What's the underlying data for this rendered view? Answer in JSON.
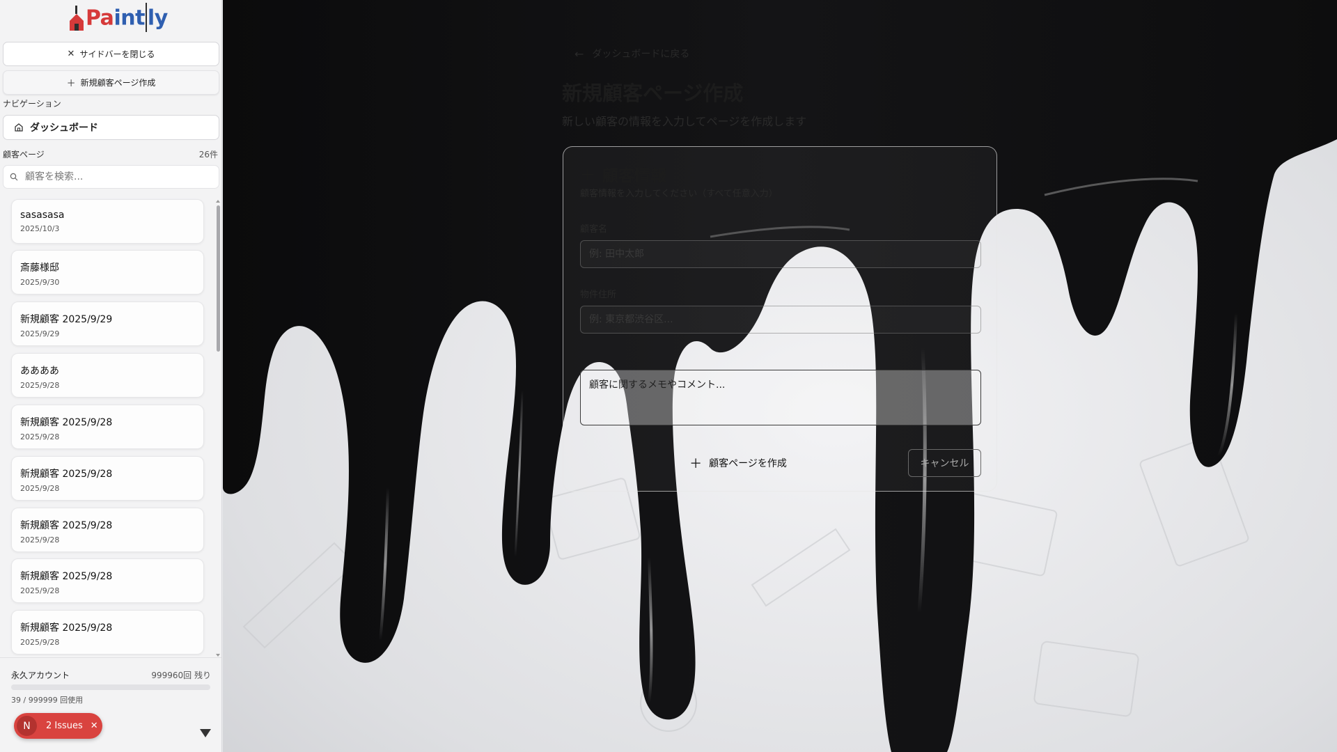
{
  "app": {
    "name_part1": "Pa",
    "name_part2": "int",
    "name_part3": "ly"
  },
  "sidebar": {
    "close_label": "サイドバーを閉じる",
    "new_page_label": "新規顧客ページ作成",
    "nav_section_label": "ナビゲーション",
    "nav_items": [
      {
        "label": "ダッシュボード",
        "icon": "home-icon"
      }
    ],
    "customers_label": "顧客ページ",
    "customers_count": "26件",
    "search_placeholder": "顧客を検索...",
    "customers": [
      {
        "name": "sasasasa",
        "date": "2025/10/3"
      },
      {
        "name": "斎藤様邸",
        "date": "2025/9/30"
      },
      {
        "name": "新規顧客 2025/9/29",
        "date": "2025/9/29"
      },
      {
        "name": "ああああ",
        "date": "2025/9/28"
      },
      {
        "name": "新規顧客 2025/9/28",
        "date": "2025/9/28"
      },
      {
        "name": "新規顧客 2025/9/28",
        "date": "2025/9/28"
      },
      {
        "name": "新規顧客 2025/9/28",
        "date": "2025/9/28"
      },
      {
        "name": "新規顧客 2025/9/28",
        "date": "2025/9/28"
      },
      {
        "name": "新規顧客 2025/9/28",
        "date": "2025/9/28"
      }
    ],
    "account": {
      "title": "永久アカウント",
      "remaining": "999960回 残り",
      "used": "39 / 999999 回使用",
      "usage_fraction": 4e-05
    }
  },
  "issues_badge": {
    "avatar": "N",
    "label": "2 Issues",
    "close": "✕"
  },
  "main": {
    "back_label": "ダッシュボードに戻る",
    "title": "新規顧客ページ作成",
    "subtitle": "新しい顧客の情報を入力してページを作成します",
    "card": {
      "title": "顧客情報",
      "description": "顧客情報を入力してください（すべて任意入力）",
      "name_label": "顧客名",
      "name_placeholder": "例: 田中太郎",
      "address_label": "物件住所",
      "address_placeholder": "例: 東京都渋谷区...",
      "notes_placeholder": "顧客に関するメモやコメント...",
      "create_label": "顧客ページを作成",
      "cancel_label": "キャンセル"
    }
  },
  "colors": {
    "logo_red": "#d63a3a",
    "logo_blue": "#2f5fb0",
    "badge_red": "#d9433f"
  }
}
